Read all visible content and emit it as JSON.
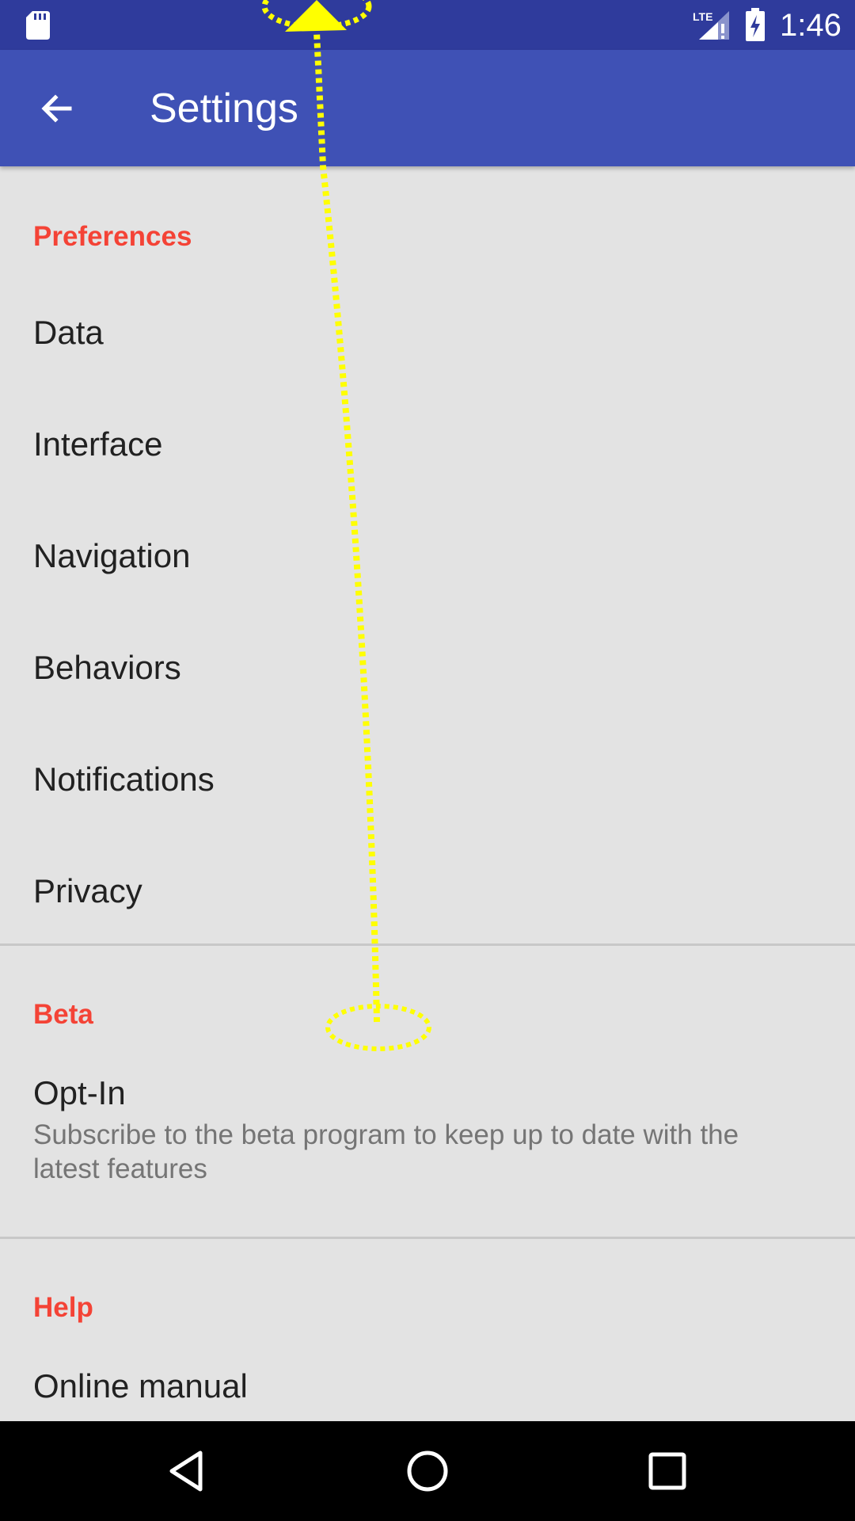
{
  "status_bar": {
    "time": "1:46",
    "network_label": "LTE",
    "icons": [
      "sd-card-icon",
      "signal-icon",
      "battery-charging-icon"
    ],
    "background": "#2f3b9c"
  },
  "app_bar": {
    "title": "Settings",
    "back_icon": "back-arrow-icon",
    "background": "#3f51b5"
  },
  "sections": {
    "preferences": {
      "header": "Preferences",
      "items": [
        "Data",
        "Interface",
        "Navigation",
        "Behaviors",
        "Notifications",
        "Privacy"
      ]
    },
    "beta": {
      "header": "Beta",
      "opt_in": {
        "title": "Opt-In",
        "summary": "Subscribe to the beta program to keep up to date with the latest features"
      }
    },
    "help": {
      "header": "Help",
      "items": [
        "Online manual"
      ]
    }
  },
  "nav_bar": {
    "icons": [
      "back-triangle-icon",
      "home-circle-icon",
      "recents-square-icon"
    ]
  },
  "colors": {
    "accent": "#f44336",
    "gesture": "#ffff00",
    "background": "#e3e3e3"
  },
  "gesture": {
    "type": "swipe-up"
  }
}
